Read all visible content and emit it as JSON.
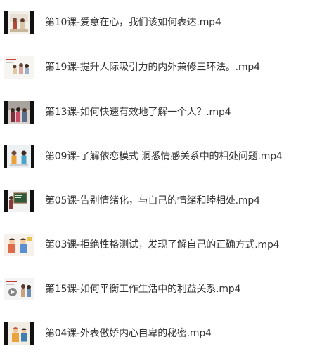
{
  "files": [
    {
      "name": "第10课-爱意在心，我们该如何表达.mp4",
      "thumb": "couple-classroom-thumbnail"
    },
    {
      "name": "第19课-提升人际吸引力的内外兼修三环法。.mp4",
      "thumb": "slide-people-thumbnail"
    },
    {
      "name": "第13课-如何快速有效地了解一个人？.mp4",
      "thumb": "crowd-street-thumbnail"
    },
    {
      "name": "第09课-了解依恋模式 洞悉情感关系中的相处问题.mp4",
      "thumb": "two-figures-thumbnail"
    },
    {
      "name": "第05课-告别情绪化，与自己的情绪和睦相处.mp4",
      "thumb": "board-presentation-thumbnail"
    },
    {
      "name": "第03课-拒绝性格测试，发现了解自己的正确方式.mp4",
      "thumb": "cartoon-people-thumbnail"
    },
    {
      "name": "第15课-如何平衡工作生活中的利益关系.mp4",
      "thumb": "video-play-thumbnail"
    },
    {
      "name": "第04课-外表傲娇内心自卑的秘密.mp4",
      "thumb": "illustration-thumbnail"
    }
  ]
}
